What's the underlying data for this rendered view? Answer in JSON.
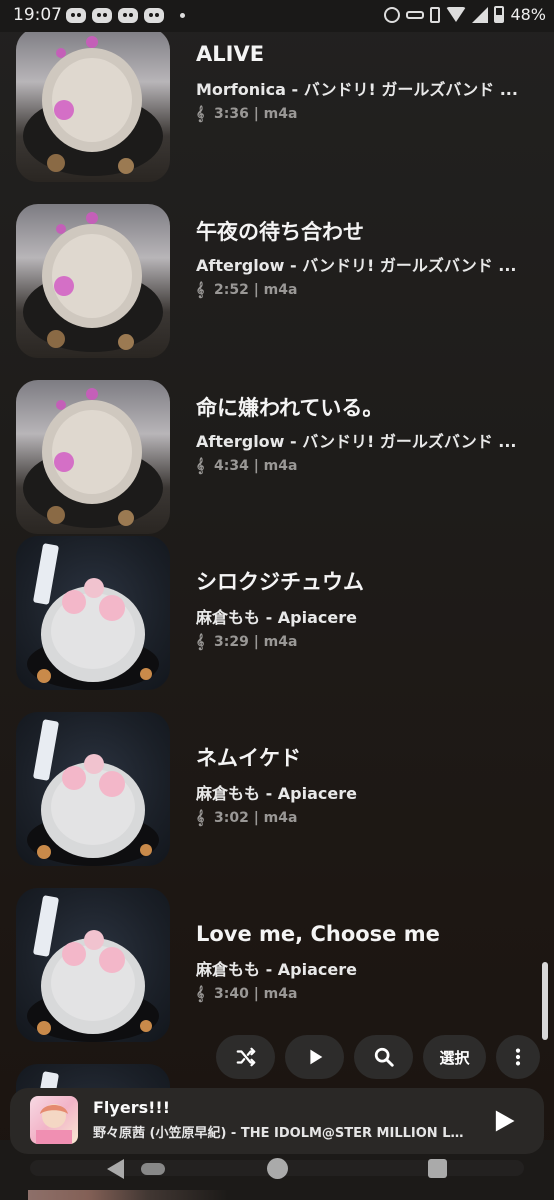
{
  "status_bar": {
    "time": "19:07",
    "battery": "48%"
  },
  "songs": [
    {
      "title": "ALIVE",
      "artist": "Morfonica - バンドリ! ガールズバンド ...",
      "meta": "3:36 | m4a",
      "art": "pink"
    },
    {
      "title": "午夜の待ち合わせ",
      "artist": "Afterglow - バンドリ! ガールズバンド ...",
      "meta": "2:52 | m4a",
      "art": "pink"
    },
    {
      "title": "命に嫌われている。",
      "artist": "Afterglow - バンドリ! ガールズバンド ...",
      "meta": "4:34 | m4a",
      "art": "pink"
    },
    {
      "title": "シロクジチュウム",
      "artist": "麻倉もも - Apiacere",
      "meta": "3:29 | m4a",
      "art": "dark"
    },
    {
      "title": "ネムイケド",
      "artist": "麻倉もも - Apiacere",
      "meta": "3:02 | m4a",
      "art": "dark"
    },
    {
      "title": "Love me, Choose me",
      "artist": "麻倉もも - Apiacere",
      "meta": "3:40 | m4a",
      "art": "dark"
    }
  ],
  "actions": {
    "shuffle_icon": "shuffle-icon",
    "play_icon": "play-icon",
    "search_icon": "search-icon",
    "select_label": "選択",
    "more_icon": "more-vertical-icon"
  },
  "now_playing": {
    "title": "Flyers!!!",
    "artist": "野々原茜 (小笠原早紀) - THE IDOLM@STER MILLION LI ..."
  },
  "colors": {
    "background": "#1e1c1a",
    "button_bg": "#2d2c2b",
    "mini_player_bg": "#2a2826",
    "meta_text": "#9a9896"
  }
}
